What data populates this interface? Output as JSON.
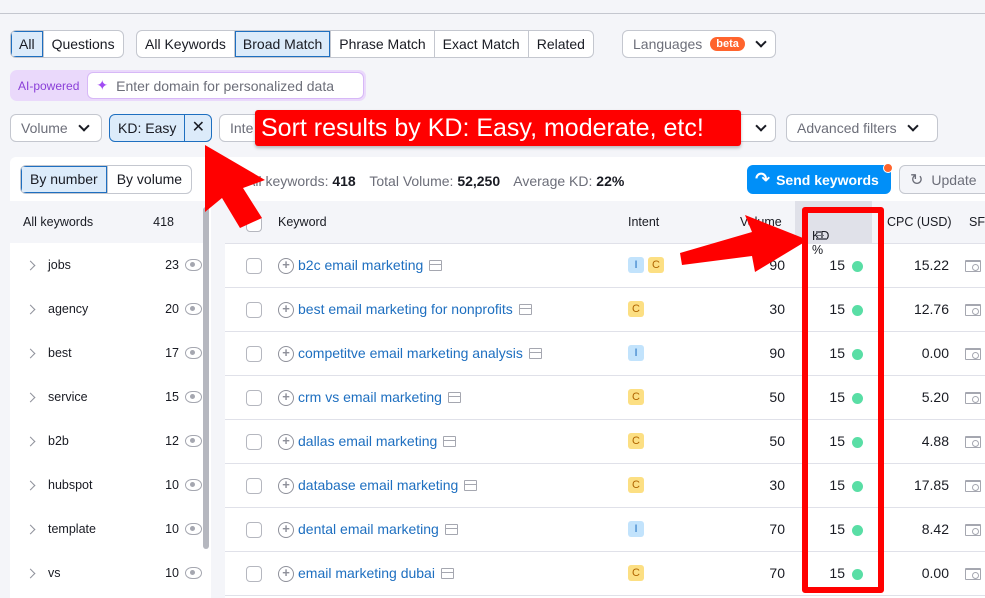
{
  "filters_row1": {
    "type_group": [
      {
        "label": "All",
        "active": true
      },
      {
        "label": "Questions",
        "active": false
      }
    ],
    "match_group": [
      {
        "label": "All Keywords",
        "active": false
      },
      {
        "label": "Broad Match",
        "active": true
      },
      {
        "label": "Phrase Match",
        "active": false
      },
      {
        "label": "Exact Match",
        "active": false
      },
      {
        "label": "Related",
        "active": false
      }
    ],
    "languages_label": "Languages",
    "languages_badge": "beta"
  },
  "ai_bar": {
    "label": "AI-powered",
    "placeholder": "Enter domain for personalized data"
  },
  "filters_row2": {
    "volume_label": "Volume",
    "kd_chip_label": "KD: Easy",
    "intent_label_partial": "Inte",
    "advanced_filters_label": "Advanced filters"
  },
  "annotation": {
    "callout_text": "Sort results by KD: Easy, moderate, etc!",
    "color": "#ff0000"
  },
  "left_panel": {
    "toggle": [
      {
        "label": "By number",
        "active": true
      },
      {
        "label": "By volume",
        "active": false
      }
    ],
    "all_label": "All keywords",
    "all_count": "418",
    "groups": [
      {
        "name": "jobs",
        "count": "23"
      },
      {
        "name": "agency",
        "count": "20"
      },
      {
        "name": "best",
        "count": "17"
      },
      {
        "name": "service",
        "count": "15"
      },
      {
        "name": "b2b",
        "count": "12"
      },
      {
        "name": "hubspot",
        "count": "10"
      },
      {
        "name": "template",
        "count": "10"
      },
      {
        "name": "vs",
        "count": "10"
      }
    ]
  },
  "stats": {
    "all_keywords_label": "All keywords:",
    "all_keywords_value": "418",
    "total_volume_label": "Total Volume:",
    "total_volume_value": "52,250",
    "avg_kd_label": "Average KD:",
    "avg_kd_value": "22%"
  },
  "actions": {
    "send_keywords": "Send keywords",
    "update": "Update"
  },
  "table": {
    "columns": {
      "keyword": "Keyword",
      "intent": "Intent",
      "volume": "Volume",
      "kd": "KD %",
      "cpc": "CPC (USD)",
      "sf": "SF"
    },
    "rows": [
      {
        "keyword": "b2c email marketing",
        "intent": [
          "I",
          "C"
        ],
        "volume": "90",
        "kd": "15",
        "cpc": "15.22"
      },
      {
        "keyword": "best email marketing for nonprofits",
        "intent": [
          "C"
        ],
        "volume": "30",
        "kd": "15",
        "cpc": "12.76"
      },
      {
        "keyword": "competitve email marketing analysis",
        "intent": [
          "I"
        ],
        "volume": "90",
        "kd": "15",
        "cpc": "0.00"
      },
      {
        "keyword": "crm vs email marketing",
        "intent": [
          "C"
        ],
        "volume": "50",
        "kd": "15",
        "cpc": "5.20"
      },
      {
        "keyword": "dallas email marketing",
        "intent": [
          "C"
        ],
        "volume": "50",
        "kd": "15",
        "cpc": "4.88"
      },
      {
        "keyword": "database email marketing",
        "intent": [
          "C"
        ],
        "volume": "30",
        "kd": "15",
        "cpc": "17.85"
      },
      {
        "keyword": "dental email marketing",
        "intent": [
          "I"
        ],
        "volume": "70",
        "kd": "15",
        "cpc": "8.42"
      },
      {
        "keyword": "email marketing dubai",
        "intent": [
          "C"
        ],
        "volume": "70",
        "kd": "15",
        "cpc": "0.00"
      }
    ],
    "kd_dot_color": "#59dea5"
  }
}
